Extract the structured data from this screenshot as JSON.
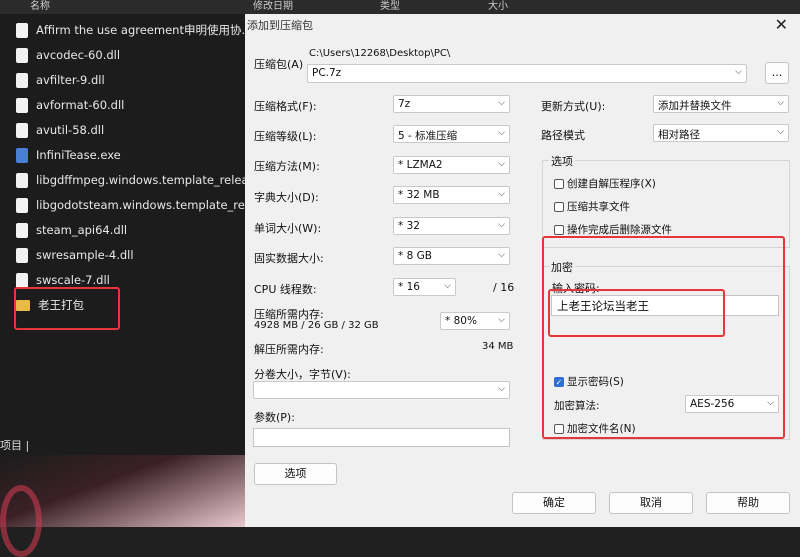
{
  "explorer": {
    "header": {
      "name": "名称",
      "modified": "修改日期",
      "type": "类型",
      "size": "大小"
    },
    "files": [
      {
        "name": "Affirm the use agreement申明使用协...",
        "icon": "document-icon"
      },
      {
        "name": "avcodec-60.dll",
        "icon": "document-icon"
      },
      {
        "name": "avfilter-9.dll",
        "icon": "document-icon"
      },
      {
        "name": "avformat-60.dll",
        "icon": "document-icon"
      },
      {
        "name": "avutil-58.dll",
        "icon": "document-icon"
      },
      {
        "name": "InfiniTease.exe",
        "icon": "exe-icon"
      },
      {
        "name": "libgdffmpeg.windows.template_relea...",
        "icon": "document-icon"
      },
      {
        "name": "libgodotsteam.windows.template_rel...",
        "icon": "document-icon"
      },
      {
        "name": "steam_api64.dll",
        "icon": "document-icon"
      },
      {
        "name": "swresample-4.dll",
        "icon": "document-icon"
      },
      {
        "name": "swscale-7.dll",
        "icon": "document-icon"
      },
      {
        "name": "老王打包",
        "icon": "folder-icon"
      }
    ],
    "status": "项目"
  },
  "dialog": {
    "title": "添加到压缩包",
    "archive_label": "压缩包(A)",
    "archive_path": "C:\\Users\\12268\\Desktop\\PC\\",
    "archive_name": "PC.7z",
    "browse_label": "...",
    "format": {
      "label": "压缩格式(F):",
      "value": "7z"
    },
    "level": {
      "label": "压缩等级(L):",
      "value": "5 - 标准压缩"
    },
    "method": {
      "label": "压缩方法(M):",
      "value": "* LZMA2"
    },
    "dict": {
      "label": "字典大小(D):",
      "value": "* 32 MB"
    },
    "word": {
      "label": "单词大小(W):",
      "value": "* 32"
    },
    "solid": {
      "label": "固实数据大小:",
      "value": "* 8 GB"
    },
    "threads": {
      "label": "CPU 线程数:",
      "value": "* 16",
      "max": "/ 16"
    },
    "memory": {
      "label": "压缩所需内存:",
      "detail": "4928 MB / 26 GB / 32 GB",
      "value": "* 80%"
    },
    "decompress": {
      "label": "解压所需内存:",
      "value": "34 MB"
    },
    "split": {
      "label": "分卷大小，字节(V):",
      "value": ""
    },
    "params": {
      "label": "参数(P):",
      "value": ""
    },
    "options_button": "选项",
    "update": {
      "label": "更新方式(U):",
      "value": "添加并替换文件"
    },
    "path_mode": {
      "label": "路径模式",
      "value": "相对路径"
    },
    "options_group": {
      "title": "选项",
      "sfx": "创建自解压程序(X)",
      "shared": "压缩共享文件",
      "delete": "操作完成后删除源文件"
    },
    "encryption": {
      "title": "加密",
      "password_label": "输入密码:",
      "password_value": "上老王论坛当老王",
      "show_password": "显示密码(S)",
      "method_label": "加密算法:",
      "method_value": "AES-256",
      "encrypt_names": "加密文件名(N)"
    },
    "ok": "确定",
    "cancel": "取消",
    "help": "帮助"
  }
}
